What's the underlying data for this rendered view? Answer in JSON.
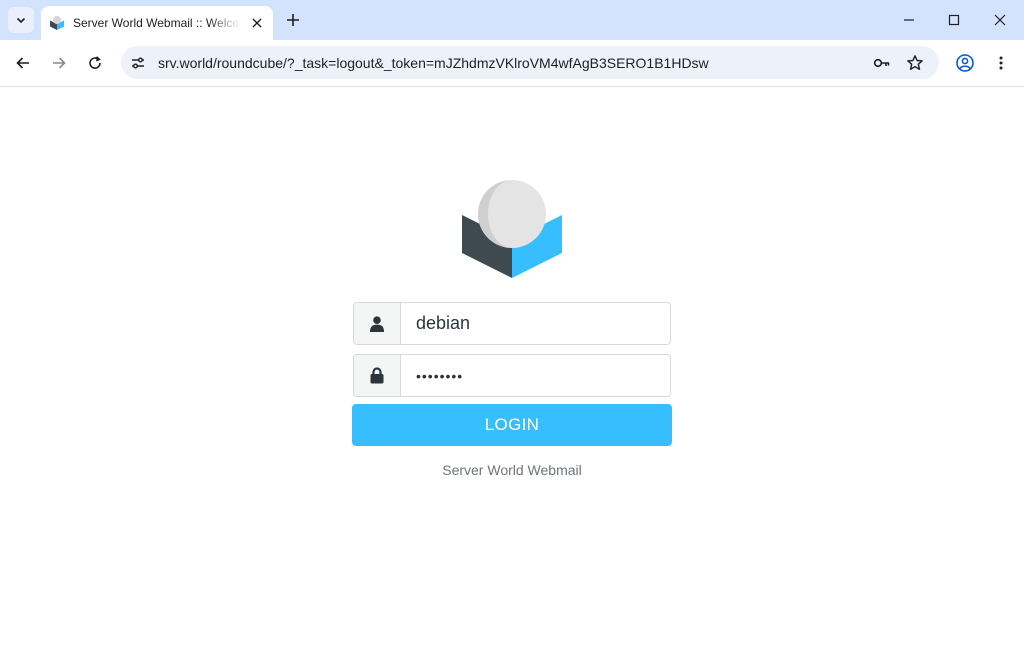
{
  "browser": {
    "tab_title": "Server World Webmail :: Welcome to Server World Webmail",
    "url": "srv.world/roundcube/?_task=logout&_token=mJZhdmzVKlroVM4wfAgB3SERO1B1HDsw"
  },
  "login": {
    "username_value": "debian",
    "password_value": "••••••••",
    "button_label": "LOGIN",
    "product_name": "Server World Webmail"
  },
  "colors": {
    "accent": "#37beff",
    "titlebar": "#d3e3fd"
  },
  "icons": {
    "username": "user-icon",
    "password": "lock-icon"
  }
}
